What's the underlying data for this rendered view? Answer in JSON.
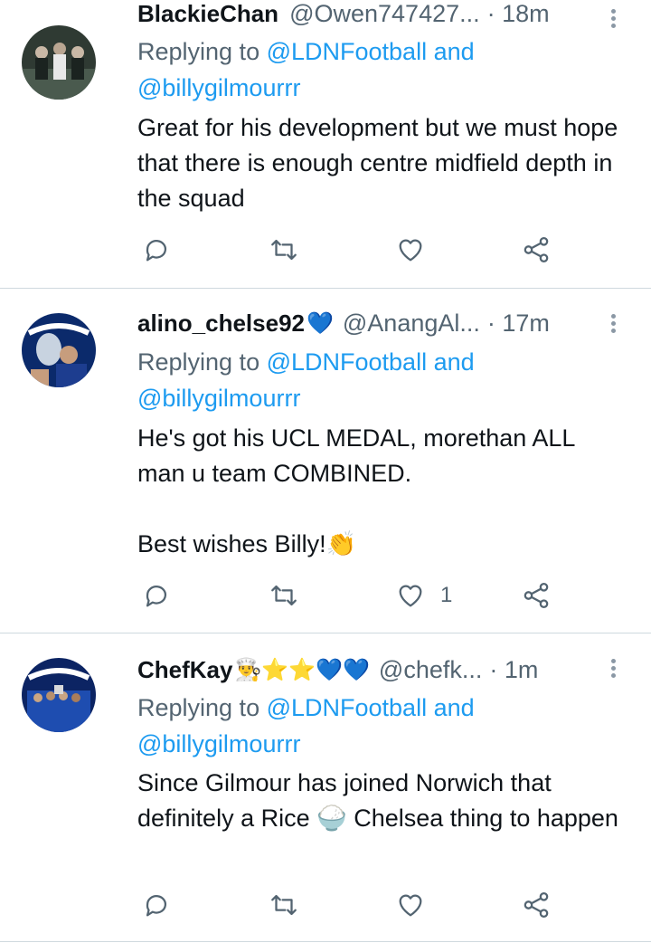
{
  "tweets": [
    {
      "name": "BlackieChan",
      "emoji": "",
      "handle": "@Owen747427...",
      "time": "· 18m",
      "replying_prefix": "Replying to ",
      "mention1": "@LDNFootball",
      "and": " and",
      "mention2": "@billygilmourrr",
      "text": "Great for his development but we must hope that there is enough centre midfield depth in the squad",
      "likes": ""
    },
    {
      "name": "alino_chelse92",
      "emoji": "💙",
      "handle": "@AnangAl...",
      "time": "· 17m",
      "replying_prefix": "Replying to ",
      "mention1": "@LDNFootball",
      "and": " and",
      "mention2": "@billygilmourrr",
      "text": "He's got his UCL MEDAL, morethan ALL man u team COMBINED.\n\nBest wishes Billy!👏",
      "likes": "1"
    },
    {
      "name": "ChefKay",
      "emoji": "👨‍🍳⭐⭐💙💙",
      "handle": "@chefk...",
      "time": "· 1m",
      "replying_prefix": "Replying to ",
      "mention1": "@LDNFootball",
      "and": " and",
      "mention2": "@billygilmourrr",
      "text": "Since Gilmour has joined Norwich that definitely a Rice 🍚 Chelsea thing to happen",
      "likes": ""
    }
  ],
  "icons": {
    "reply": "reply-icon",
    "retweet": "retweet-icon",
    "like": "heart-icon",
    "share": "share-icon",
    "more": "more-vertical-icon"
  },
  "colors": {
    "link": "#1d9bf0",
    "secondary_text": "#536471",
    "icon": "#536471",
    "divider": "#cfd9de"
  }
}
